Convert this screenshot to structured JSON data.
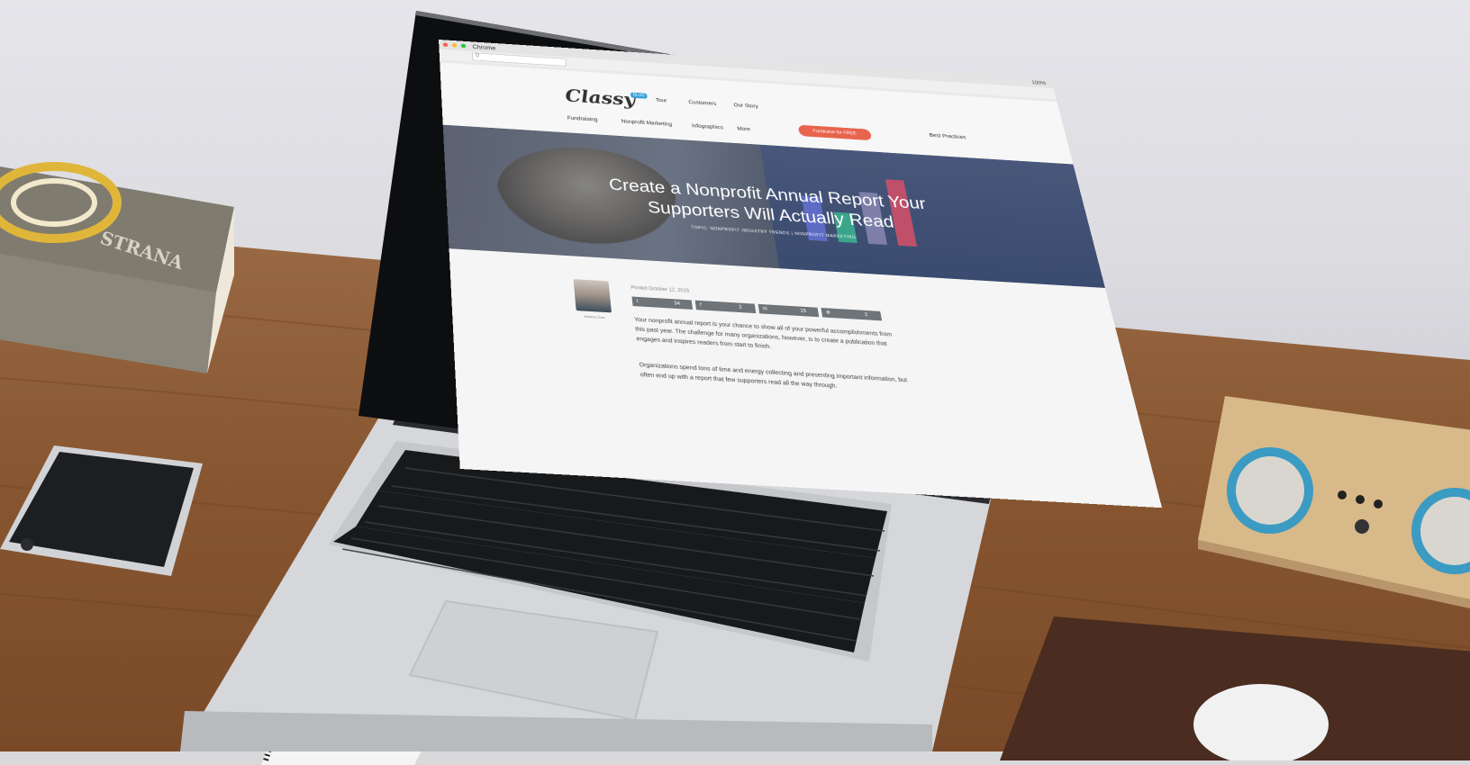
{
  "browser": {
    "app_name": "Chrome",
    "status_text": "100%",
    "url_placeholder": "Q"
  },
  "site": {
    "logo": "Classy",
    "logo_badge": "BLOG",
    "top_nav": [
      "Tour",
      "Customers",
      "Our Story"
    ],
    "sub_nav": [
      "Fundraising",
      "Nonprofit Marketing",
      "Infographics",
      "More"
    ],
    "cta_label": "Fundraise for FREE",
    "best_practices": "Best Practices"
  },
  "hero": {
    "title_line1": "Create a Nonprofit Annual Report Your",
    "title_line2": "Supporters Will Actually Read",
    "topic": "TOPIC: NONPROFIT INDUSTRY TRENDS | NONPROFIT MARKETING"
  },
  "article": {
    "author_name": "Jessica Chan",
    "posted": "Posted October 12, 2015",
    "shares": [
      {
        "network_glyph": "t",
        "count": "34"
      },
      {
        "network_glyph": "f",
        "count": "2"
      },
      {
        "network_glyph": "in",
        "count": "15"
      },
      {
        "network_glyph": "⊕",
        "count": "2"
      }
    ],
    "para1": "Your nonprofit annual report is your chance to show all of your powerful accomplishments from this past year. The challenge for many organizations, however, is to create a publication that engages and inspires readers from start to finish.",
    "para2": "Organizations spend tons of time and energy collecting and presenting important information, but often end up with a report that few supporters read all the way through."
  },
  "colors": {
    "cta": "#e8644e",
    "hero_overlay": "#5b6170",
    "desk": "#8a5a36",
    "speaker_ring": "#3b9bc2"
  }
}
